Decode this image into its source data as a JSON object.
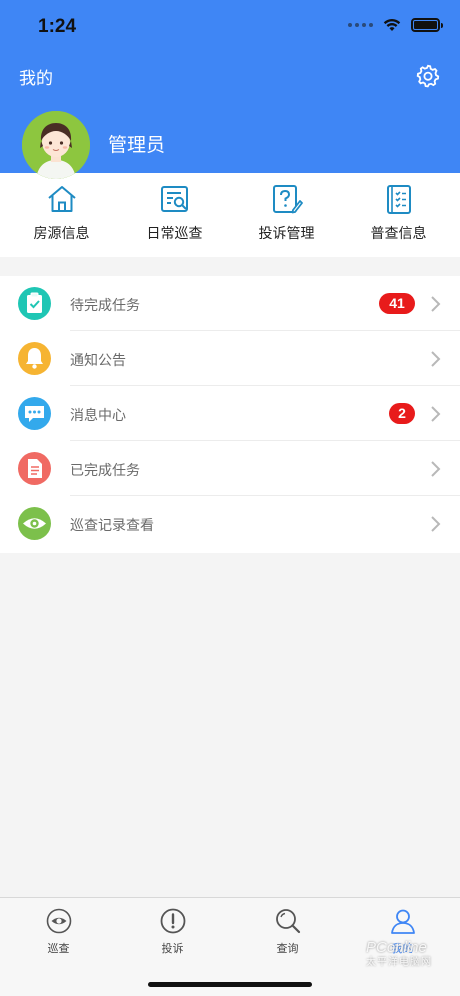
{
  "status_bar": {
    "time": "1:24"
  },
  "header": {
    "title": "我的",
    "settings_icon": "gear-icon",
    "user_name": "管理员",
    "background": "#3f86f5"
  },
  "quick_actions": [
    {
      "label": "房源信息",
      "icon": "house-icon"
    },
    {
      "label": "日常巡查",
      "icon": "inspection-icon"
    },
    {
      "label": "投诉管理",
      "icon": "complaint-icon"
    },
    {
      "label": "普查信息",
      "icon": "census-icon"
    }
  ],
  "menu": [
    {
      "label": "待完成任务",
      "icon": "clipboard-check-icon",
      "icon_color": "#1fc6b4",
      "badge": "41"
    },
    {
      "label": "通知公告",
      "icon": "bell-icon",
      "icon_color": "#f6b432",
      "badge": ""
    },
    {
      "label": "消息中心",
      "icon": "chat-icon",
      "icon_color": "#33a9ec",
      "badge": "2"
    },
    {
      "label": "已完成任务",
      "icon": "document-icon",
      "icon_color": "#f06a63",
      "badge": ""
    },
    {
      "label": "巡查记录查看",
      "icon": "eye-icon",
      "icon_color": "#7cc04b",
      "badge": ""
    }
  ],
  "tabbar": [
    {
      "label": "巡查",
      "icon": "eye-icon",
      "active": false
    },
    {
      "label": "投诉",
      "icon": "exclamation-icon",
      "active": false
    },
    {
      "label": "查询",
      "icon": "search-icon",
      "active": false
    },
    {
      "label": "我的",
      "icon": "user-icon",
      "active": true
    }
  ],
  "colors": {
    "accent": "#3f86f5",
    "badge": "#e81b1b",
    "active_tab": "#3f86f5"
  },
  "watermark": {
    "brand": "PConline",
    "sub": "太平洋电脑网"
  }
}
